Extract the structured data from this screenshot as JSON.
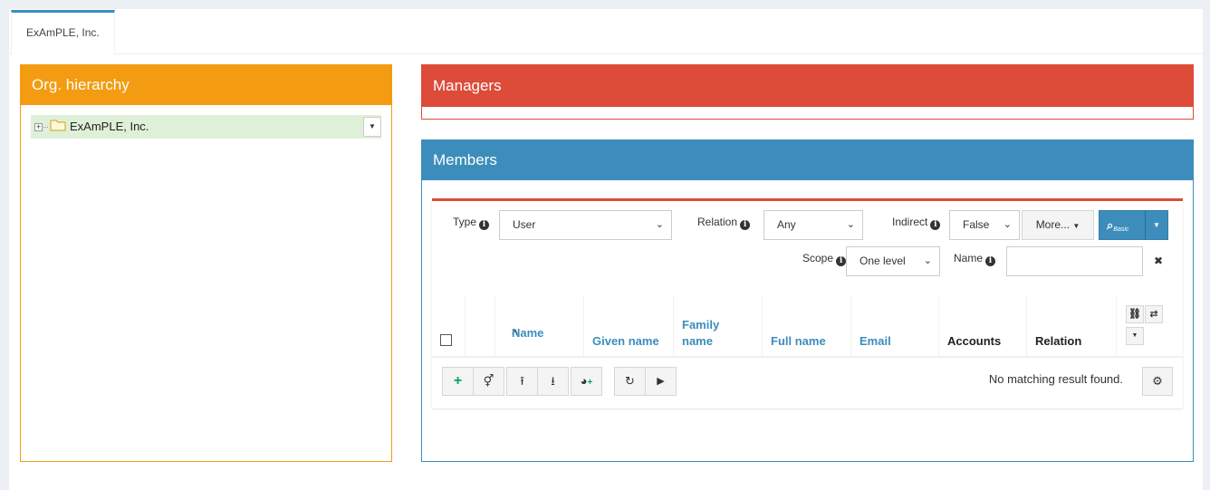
{
  "tabs": [
    {
      "label": "ExAmPLE, Inc."
    }
  ],
  "org_panel": {
    "title": "Org. hierarchy",
    "tree": [
      {
        "label": "ExAmPLE, Inc.",
        "expand_symbol": "+",
        "selected": true
      }
    ]
  },
  "managers_panel": {
    "title": "Managers"
  },
  "members_panel": {
    "title": "Members",
    "filters": {
      "type": {
        "label": "Type",
        "value": "User"
      },
      "relation": {
        "label": "Relation",
        "value": "Any"
      },
      "indirect": {
        "label": "Indirect",
        "value": "False"
      },
      "more": {
        "label": "More..."
      },
      "search_mode": {
        "label": "Basic"
      },
      "scope": {
        "label": "Scope",
        "value": "One level"
      },
      "name": {
        "label": "Name",
        "value": "",
        "clear_symbol": "✖"
      }
    },
    "table": {
      "columns": [
        {
          "key": "name",
          "label": "Name",
          "sort": "asc"
        },
        {
          "key": "given_name",
          "label": "Given name"
        },
        {
          "key": "family_name",
          "label": "Family name"
        },
        {
          "key": "full_name",
          "label": "Full name"
        },
        {
          "key": "email",
          "label": "Email"
        },
        {
          "key": "accounts",
          "label": "Accounts"
        },
        {
          "key": "relation",
          "label": "Relation"
        }
      ],
      "rows": [],
      "empty_message": "No matching result found.",
      "sort_icon": "^"
    },
    "actions": [
      {
        "icon": "plus-icon"
      },
      {
        "icon": "link-user-icon"
      },
      {
        "icon": "upload-icon"
      },
      {
        "icon": "download-icon"
      },
      {
        "icon": "add-chart-icon"
      },
      {
        "icon": "refresh-icon"
      },
      {
        "icon": "play-icon"
      }
    ]
  },
  "colors": {
    "orange": "#f39c12",
    "red": "#dd4b39",
    "blue": "#3c8dbc",
    "tree_selected": "#dff0d8",
    "add_green": "#00a65a"
  }
}
